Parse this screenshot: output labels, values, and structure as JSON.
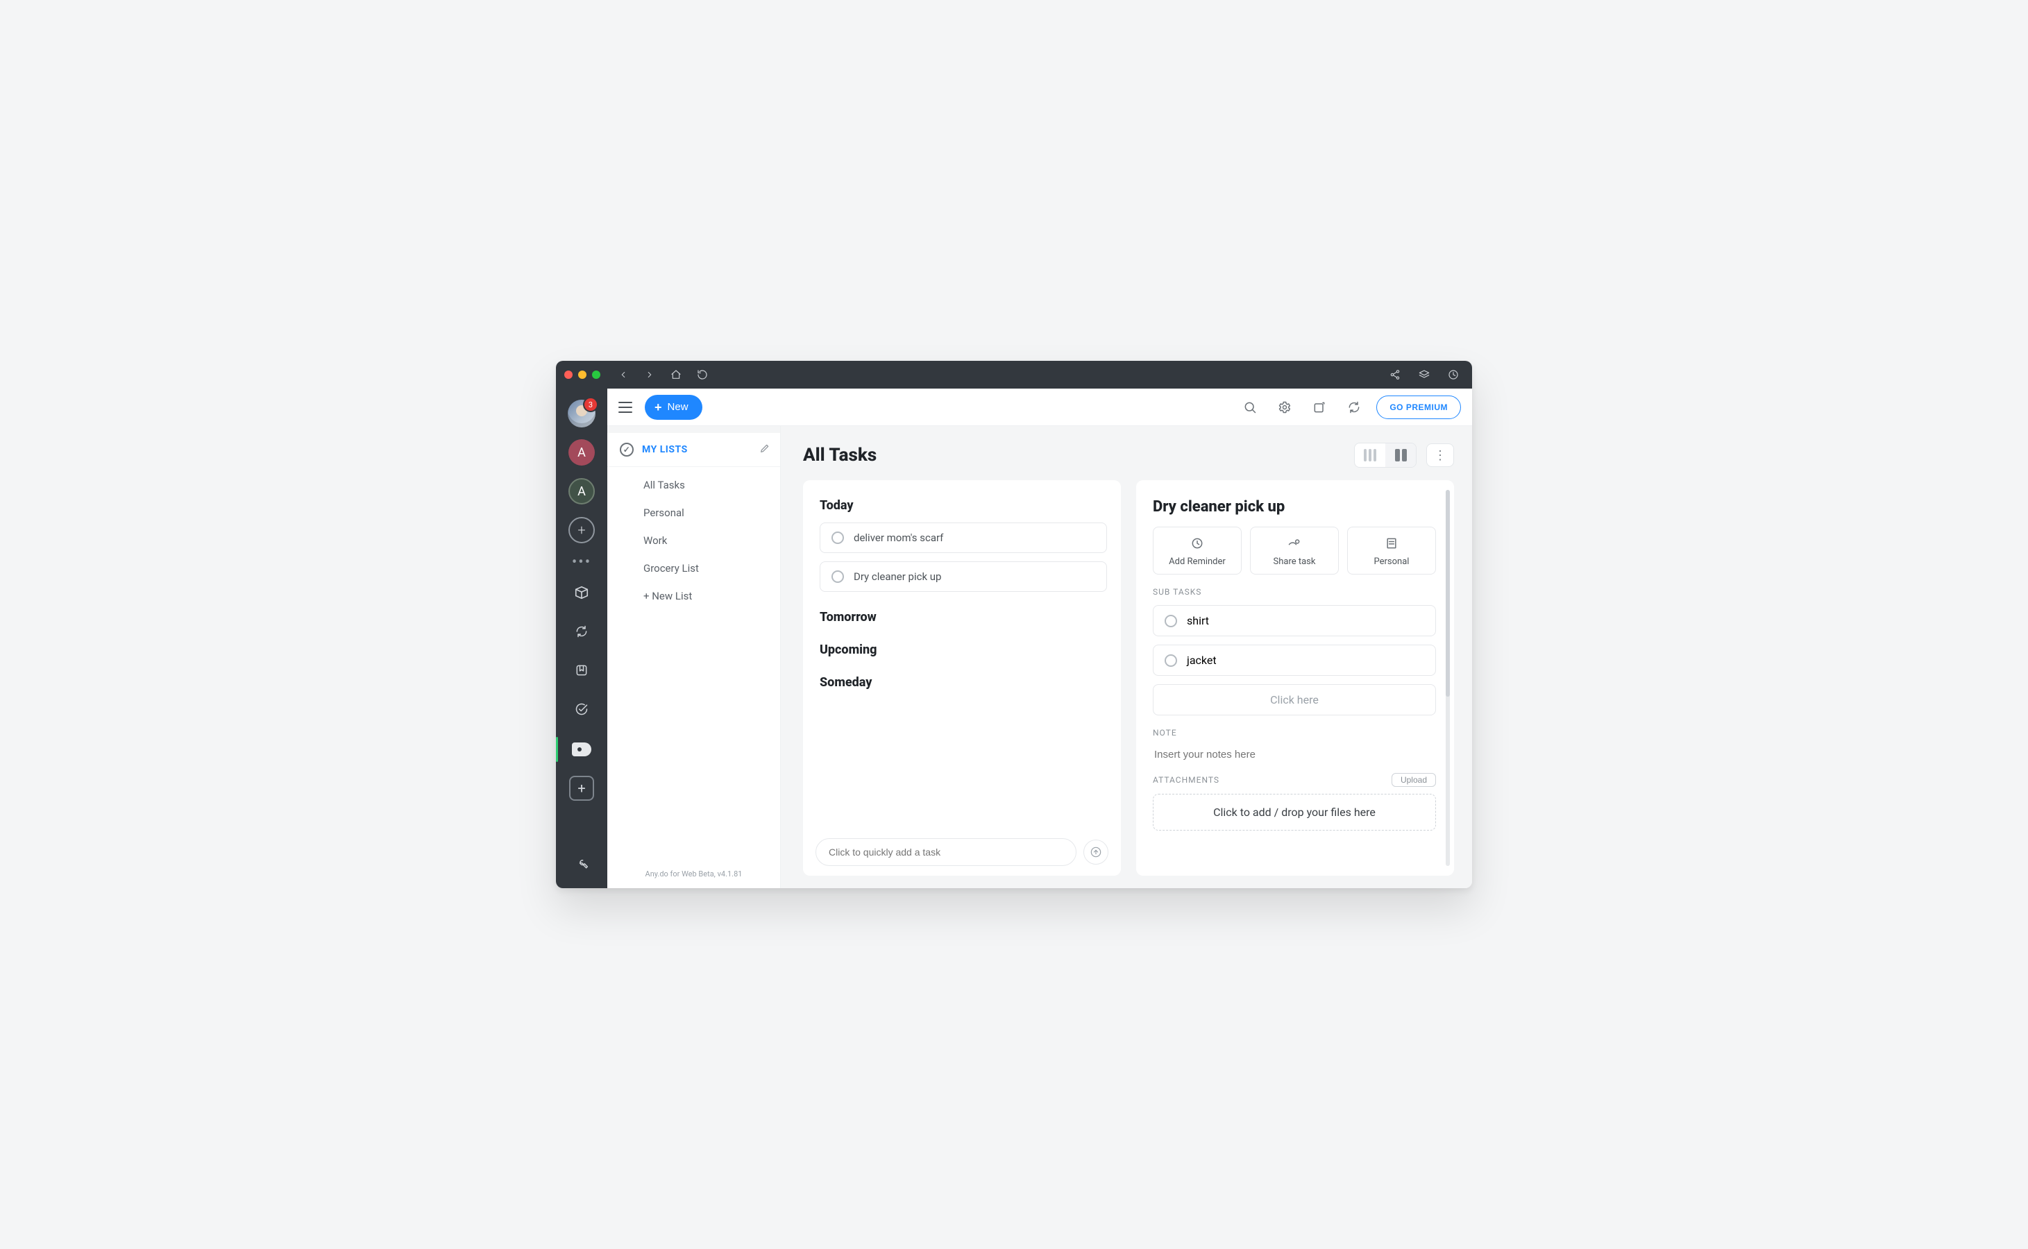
{
  "rail": {
    "badge_count": "3",
    "avatar_letter_1": "A",
    "avatar_letter_2": "A"
  },
  "header": {
    "new_button": "New",
    "go_premium": "GO PREMIUM"
  },
  "sidebar": {
    "heading": "MY LISTS",
    "items": [
      "All Tasks",
      "Personal",
      "Work",
      "Grocery List",
      "+ New List"
    ],
    "footer": "Any.do for Web Beta, v4.1.81"
  },
  "main": {
    "title": "All Tasks",
    "sections": {
      "today": "Today",
      "tomorrow": "Tomorrow",
      "upcoming": "Upcoming",
      "someday": "Someday"
    },
    "tasks_today": [
      "deliver mom's scarf",
      "Dry cleaner pick up"
    ],
    "quick_add_placeholder": "Click to quickly add a task"
  },
  "detail": {
    "title": "Dry cleaner pick up",
    "tiles": {
      "reminder": "Add Reminder",
      "share": "Share task",
      "list": "Personal"
    },
    "subtasks_heading": "SUB TASKS",
    "subtasks": [
      "shirt",
      "jacket"
    ],
    "add_sub_placeholder": "Click here",
    "note_heading": "NOTE",
    "note_placeholder": "Insert your notes here",
    "attachments_heading": "ATTACHMENTS",
    "upload_label": "Upload",
    "dropzone": "Click to add / drop your files here"
  }
}
